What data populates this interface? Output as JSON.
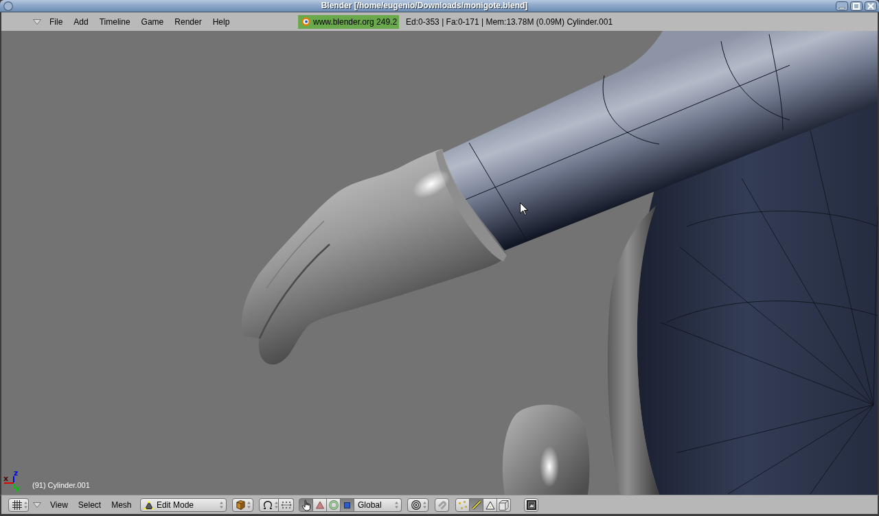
{
  "window": {
    "title": "Blender [/home/eugenio/Downloads/monigote.blend]"
  },
  "top_header": {
    "menus": [
      "File",
      "Add",
      "Timeline",
      "Game",
      "Render",
      "Help"
    ],
    "badge": "www.blender.org 249.2",
    "stats": "Ed:0-353 | Fa:0-171 | Mem:13.78M (0.09M) Cylinder.001"
  },
  "viewport": {
    "axes": [
      {
        "label": "x",
        "color": "#e00000"
      },
      {
        "label": "y",
        "color": "#00c800"
      },
      {
        "label": "z",
        "color": "#0000f0"
      }
    ],
    "object_info": "(91) Cylinder.001"
  },
  "bottom_header": {
    "menus": [
      "View",
      "Select",
      "Mesh"
    ],
    "mode": "Edit Mode",
    "manipulators": [
      {
        "kind": "hand",
        "selected": true
      },
      {
        "kind": "translate",
        "selected": false
      },
      {
        "kind": "rotate",
        "selected": false
      },
      {
        "kind": "scale",
        "selected": true
      }
    ],
    "orientation": "Global",
    "select_modes": [
      {
        "kind": "vertex",
        "selected": false
      },
      {
        "kind": "edge",
        "selected": true
      },
      {
        "kind": "face",
        "selected": false
      }
    ]
  }
}
